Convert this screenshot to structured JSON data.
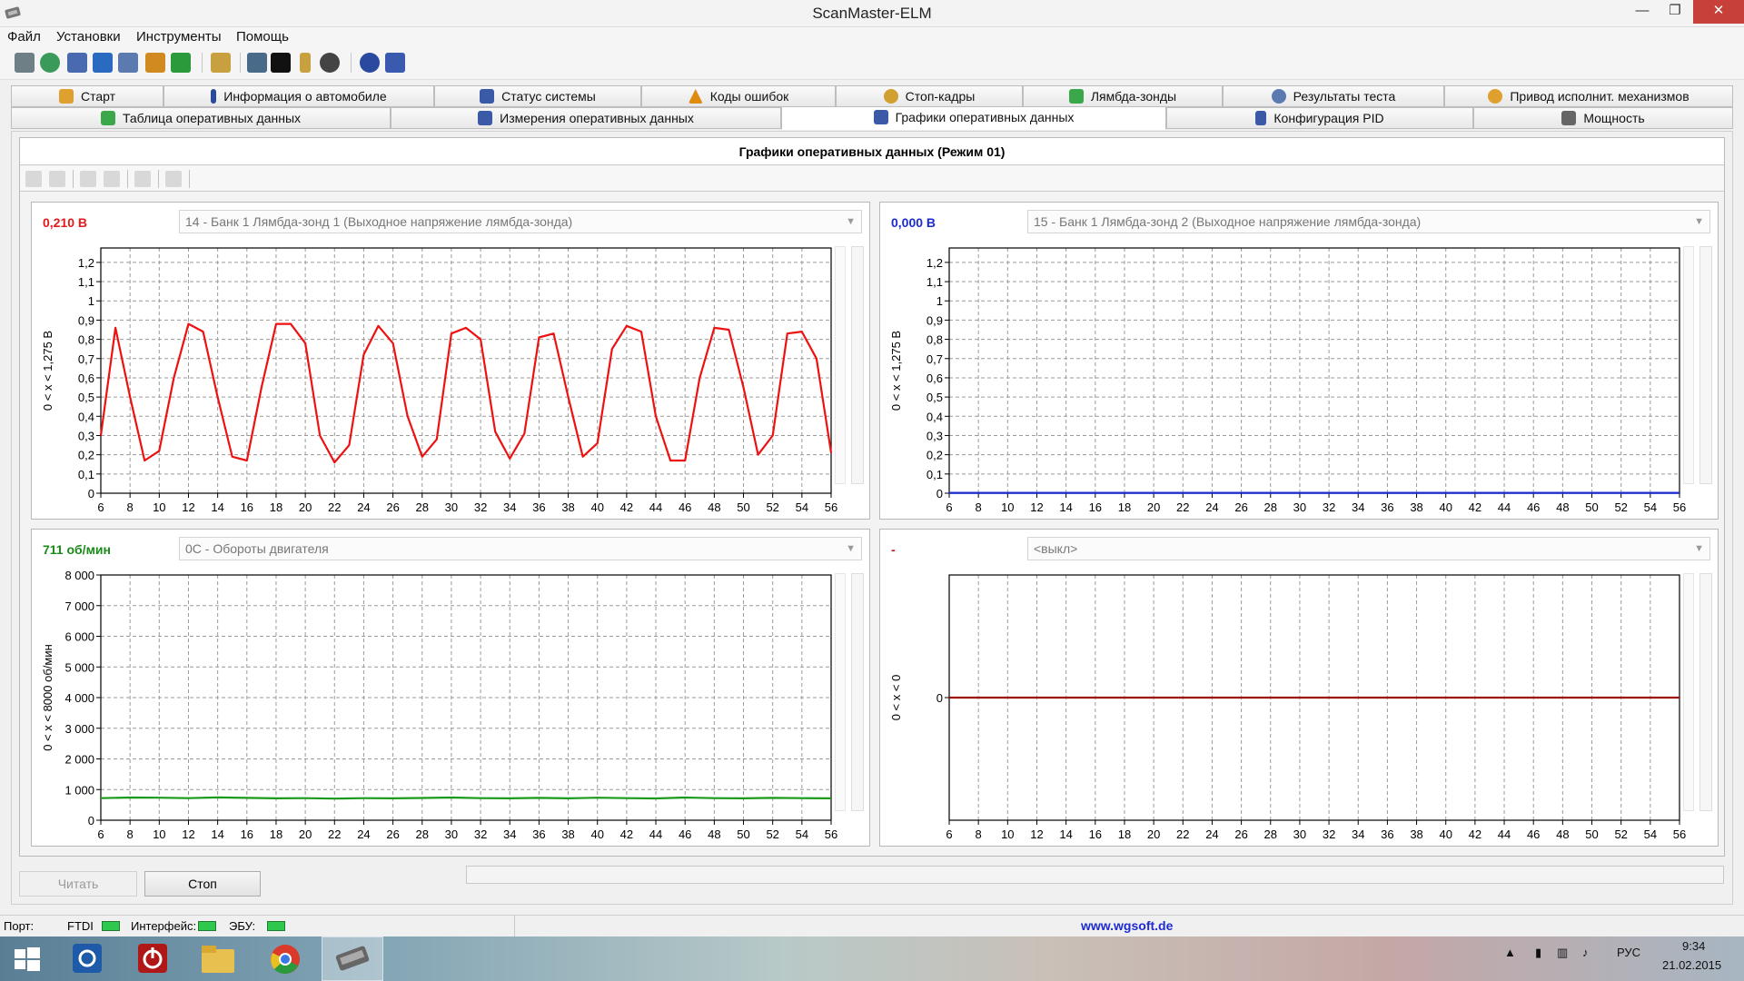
{
  "window": {
    "title": "ScanMaster-ELM",
    "minimize": "—",
    "maximize": "❐",
    "close": "✕"
  },
  "menu": [
    "Файл",
    "Установки",
    "Инструменты",
    "Помощь"
  ],
  "tabs_row1": [
    {
      "label": "Старт",
      "icon": "start-icon",
      "color": "#e0a030"
    },
    {
      "label": "Информация о автомобиле",
      "icon": "info-icon",
      "color": "#2a4a9a"
    },
    {
      "label": "Статус системы",
      "icon": "status-icon",
      "color": "#3a5aa8"
    },
    {
      "label": "Коды ошибок",
      "icon": "warning-icon",
      "color": "#e08a10"
    },
    {
      "label": "Стоп-кадры",
      "icon": "freeze-frame-icon",
      "color": "#d0a030"
    },
    {
      "label": "Лямбда-зонды",
      "icon": "lambda-icon",
      "color": "#3aa84a"
    },
    {
      "label": "Результаты теста",
      "icon": "gear-icon",
      "color": "#5a7ab0"
    },
    {
      "label": "Привод исполнит. механизмов",
      "icon": "actuator-icon",
      "color": "#e0a030"
    }
  ],
  "tabs_row2": [
    {
      "label": "Таблица оперативных данных",
      "icon": "table-icon",
      "color": "#3aa84a"
    },
    {
      "label": "Измерения оперативных данных",
      "icon": "grid-icon",
      "color": "#3a5aa8"
    },
    {
      "label": "Графики оперативных данных",
      "icon": "chart-icon",
      "color": "#3a5aa8",
      "active": true
    },
    {
      "label": "Конфигурация PID",
      "icon": "config-icon",
      "color": "#3a5aa8"
    },
    {
      "label": "Мощность",
      "icon": "power-icon",
      "color": "#666666"
    }
  ],
  "content": {
    "header": "Графики оперативных данных (Режим 01)"
  },
  "charts": [
    {
      "readout": "0,210 В",
      "readout_color": "#e21a1a",
      "pid": "14 - Банк 1 Лямбда-зонд 1 (Выходное напряжение лямбда-зонда)",
      "ylabel": "0  < x <  1,275 В",
      "line_color": "#ee1111",
      "yticks": [
        "0",
        "0,1",
        "0,2",
        "0,3",
        "0,4",
        "0,5",
        "0,6",
        "0,7",
        "0,8",
        "0,9",
        "1",
        "1,1",
        "1,2"
      ],
      "ymin": 0,
      "ymax": 1.275,
      "xticks": [
        "6",
        "8",
        "10",
        "12",
        "14",
        "16",
        "18",
        "20",
        "22",
        "24",
        "26",
        "28",
        "30",
        "32",
        "34",
        "36",
        "38",
        "40",
        "42",
        "44",
        "46",
        "48",
        "50",
        "52",
        "54",
        "56"
      ],
      "x": [
        6,
        7,
        8,
        9,
        10,
        11,
        12,
        13,
        14,
        15,
        16,
        17,
        18,
        19,
        20,
        21,
        22,
        23,
        24,
        25,
        26,
        27,
        28,
        29,
        30,
        31,
        32,
        33,
        34,
        35,
        36,
        37,
        38,
        39,
        40,
        41,
        42,
        43,
        44,
        45,
        46,
        47,
        48,
        49,
        50,
        51,
        52,
        53,
        54,
        55,
        56
      ],
      "y": [
        0.3,
        0.86,
        0.5,
        0.17,
        0.22,
        0.6,
        0.88,
        0.84,
        0.5,
        0.19,
        0.17,
        0.55,
        0.88,
        0.88,
        0.78,
        0.3,
        0.16,
        0.25,
        0.72,
        0.87,
        0.78,
        0.4,
        0.19,
        0.28,
        0.83,
        0.86,
        0.8,
        0.32,
        0.18,
        0.31,
        0.81,
        0.83,
        0.5,
        0.19,
        0.26,
        0.75,
        0.87,
        0.84,
        0.4,
        0.17,
        0.17,
        0.6,
        0.86,
        0.85,
        0.55,
        0.2,
        0.3,
        0.83,
        0.84,
        0.7,
        0.21
      ]
    },
    {
      "readout": "0,000 В",
      "readout_color": "#1a2bd0",
      "pid": "15 - Банк 1 Лямбда-зонд 2 (Выходное напряжение лямбда-зонда)",
      "ylabel": "0  < x <  1,275 В",
      "line_color": "#1a2bd0",
      "yticks": [
        "0",
        "0,1",
        "0,2",
        "0,3",
        "0,4",
        "0,5",
        "0,6",
        "0,7",
        "0,8",
        "0,9",
        "1",
        "1,1",
        "1,2"
      ],
      "ymin": 0,
      "ymax": 1.275,
      "xticks": [
        "6",
        "8",
        "10",
        "12",
        "14",
        "16",
        "18",
        "20",
        "22",
        "24",
        "26",
        "28",
        "30",
        "32",
        "34",
        "36",
        "38",
        "40",
        "42",
        "44",
        "46",
        "48",
        "50",
        "52",
        "54",
        "56"
      ],
      "x": [
        6,
        56
      ],
      "y": [
        0.002,
        0.002
      ]
    },
    {
      "readout": "711 об/мин",
      "readout_color": "#1a8a1a",
      "pid": "0С - Обороты двигателя",
      "ylabel": "0  < x <  8000  об/мин",
      "line_color": "#1a9a1a",
      "yticks": [
        "0",
        "1 000",
        "2 000",
        "3 000",
        "4 000",
        "5 000",
        "6 000",
        "7 000",
        "8 000"
      ],
      "ymin": 0,
      "ymax": 8000,
      "xticks": [
        "6",
        "8",
        "10",
        "12",
        "14",
        "16",
        "18",
        "20",
        "22",
        "24",
        "26",
        "28",
        "30",
        "32",
        "34",
        "36",
        "38",
        "40",
        "42",
        "44",
        "46",
        "48",
        "50",
        "52",
        "54",
        "56"
      ],
      "x": [
        6,
        8,
        10,
        12,
        14,
        16,
        18,
        20,
        22,
        24,
        26,
        28,
        30,
        32,
        34,
        36,
        38,
        40,
        42,
        44,
        46,
        48,
        50,
        52,
        54,
        56
      ],
      "y": [
        720,
        740,
        735,
        720,
        745,
        730,
        715,
        720,
        705,
        720,
        715,
        725,
        740,
        720,
        715,
        730,
        715,
        735,
        720,
        710,
        740,
        720,
        715,
        730,
        720,
        715
      ]
    },
    {
      "readout": "-",
      "readout_color": "#c01a1a",
      "pid": "<выкл>",
      "ylabel": "0  < x <  0",
      "line_color": "#a01010",
      "yticks": [
        "0"
      ],
      "ymin": -1,
      "ymax": 1,
      "xticks": [
        "6",
        "8",
        "10",
        "12",
        "14",
        "16",
        "18",
        "20",
        "22",
        "24",
        "26",
        "28",
        "30",
        "32",
        "34",
        "36",
        "38",
        "40",
        "42",
        "44",
        "46",
        "48",
        "50",
        "52",
        "54",
        "56"
      ],
      "x": [
        6,
        56
      ],
      "y": [
        0,
        0
      ]
    }
  ],
  "buttons": {
    "read": "Читать",
    "stop": "Стоп"
  },
  "status": {
    "port_label": "Порт:",
    "ftdi_label": "FTDI",
    "interface_label": "Интерфейс:",
    "ecu_label": "ЭБУ:",
    "url": "www.wgsoft.de"
  },
  "taskbar": {
    "lang": "РУС",
    "time": "9:34",
    "date": "21.02.2015"
  }
}
